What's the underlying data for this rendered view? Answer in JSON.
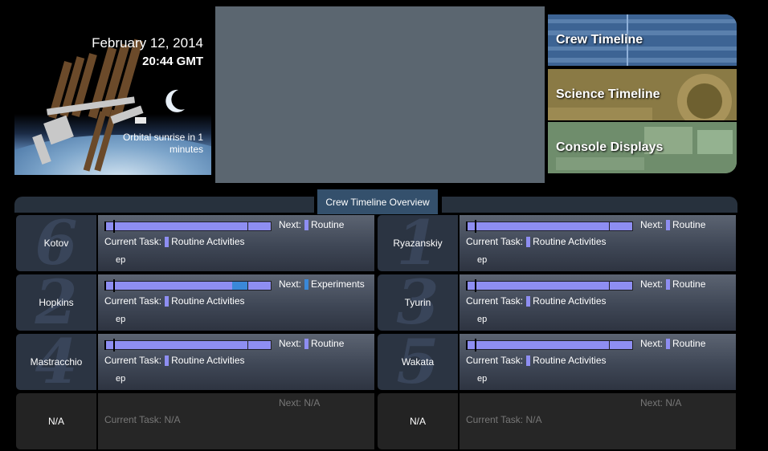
{
  "station": {
    "date": "February 12, 2014",
    "time": "20:44 GMT",
    "sunrise": "Orbital sunrise in 1 minutes"
  },
  "nav": {
    "crew_timeline": "Crew Timeline",
    "science_timeline": "Science Timeline",
    "console_displays": "Console Displays"
  },
  "overview": {
    "title": "Crew Timeline Overview"
  },
  "crew": [
    {
      "name": "Kotov",
      "next_label": "Next:",
      "next": "Routine",
      "next_color": "#8e8ef2",
      "current_label": "Current Task:",
      "current": "Routine Activities",
      "sub": "ep",
      "number": "6"
    },
    {
      "name": "Ryazanskiy",
      "next_label": "Next:",
      "next": "Routine",
      "next_color": "#8e8ef2",
      "current_label": "Current Task:",
      "current": "Routine Activities",
      "sub": "ep",
      "number": "1"
    },
    {
      "name": "Hopkins",
      "next_label": "Next:",
      "next": "Experiments",
      "next_color": "#3a88d8",
      "current_label": "Current Task:",
      "current": "Routine Activities",
      "sub": "ep",
      "number": "2"
    },
    {
      "name": "Tyurin",
      "next_label": "Next:",
      "next": "Routine",
      "next_color": "#8e8ef2",
      "current_label": "Current Task:",
      "current": "Routine Activities",
      "sub": "ep",
      "number": "3"
    },
    {
      "name": "Mastracchio",
      "next_label": "Next:",
      "next": "Routine",
      "next_color": "#8e8ef2",
      "current_label": "Current Task:",
      "current": "Routine Activities",
      "sub": "ep",
      "number": "4"
    },
    {
      "name": "Wakata",
      "next_label": "Next:",
      "next": "Routine",
      "next_color": "#8e8ef2",
      "current_label": "Current Task:",
      "current": "Routine Activities",
      "sub": "ep",
      "number": "5"
    }
  ],
  "empty_slots": [
    {
      "name": "N/A",
      "next": "Next: N/A",
      "current": "Current Task: N/A"
    },
    {
      "name": "N/A",
      "next": "Next: N/A",
      "current": "Current Task: N/A"
    }
  ]
}
